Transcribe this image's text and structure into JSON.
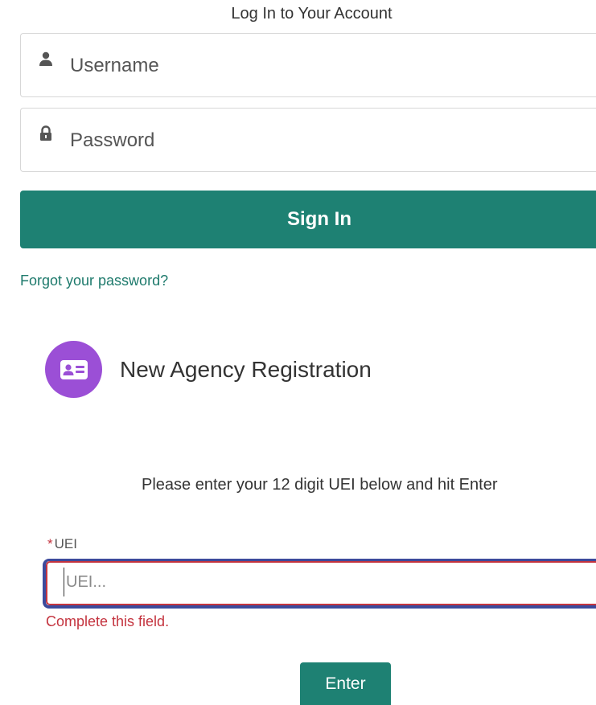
{
  "login": {
    "title": "Log In to Your Account",
    "username_placeholder": "Username",
    "username_icon": "user-icon",
    "password_placeholder": "Password",
    "password_icon": "lock-icon",
    "sign_in_label": "Sign In",
    "forgot_password_label": "Forgot your password?"
  },
  "registration": {
    "icon": "id-card-icon",
    "title": "New Agency Registration",
    "instruction": "Please enter your 12 digit UEI below and hit Enter",
    "uei_required_marker": "*",
    "uei_label": "UEI",
    "uei_placeholder": "UEI...",
    "uei_value": "",
    "error_message": "Complete this field.",
    "enter_label": "Enter"
  },
  "colors": {
    "primary": "#1e8173",
    "link": "#1e7a6c",
    "badge": "#9b4fd6",
    "error": "#c4343f",
    "focus": "#3c4a9c"
  }
}
